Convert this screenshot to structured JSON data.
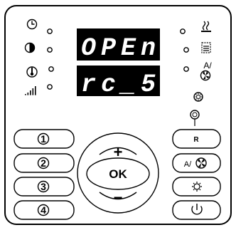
{
  "display": {
    "line1": "OPEn",
    "line2": "rc_5"
  },
  "left_indicators": [
    {
      "icon": "clock-icon"
    },
    {
      "icon": "pie-timer-icon"
    },
    {
      "icon": "thermometer-icon"
    },
    {
      "icon": "signal-bars-icon"
    }
  ],
  "right_indicators": [
    {
      "icon": "steam-icon"
    },
    {
      "icon": "water-level-icon"
    },
    {
      "icon": "auto-fan-icon"
    },
    {
      "icon": "light-icon"
    }
  ],
  "buttons": {
    "preset_1": "1",
    "preset_2": "2",
    "preset_3": "3",
    "preset_4": "4",
    "plus": "+",
    "ok": "OK",
    "minus": "−",
    "reset": "R",
    "auto_fan": "A/",
    "auto_fan_indicator": "A/"
  },
  "colors": {
    "display_bg": "#000000",
    "segment": "#ffffff",
    "panel": "#ffffff",
    "outline": "#000000"
  }
}
